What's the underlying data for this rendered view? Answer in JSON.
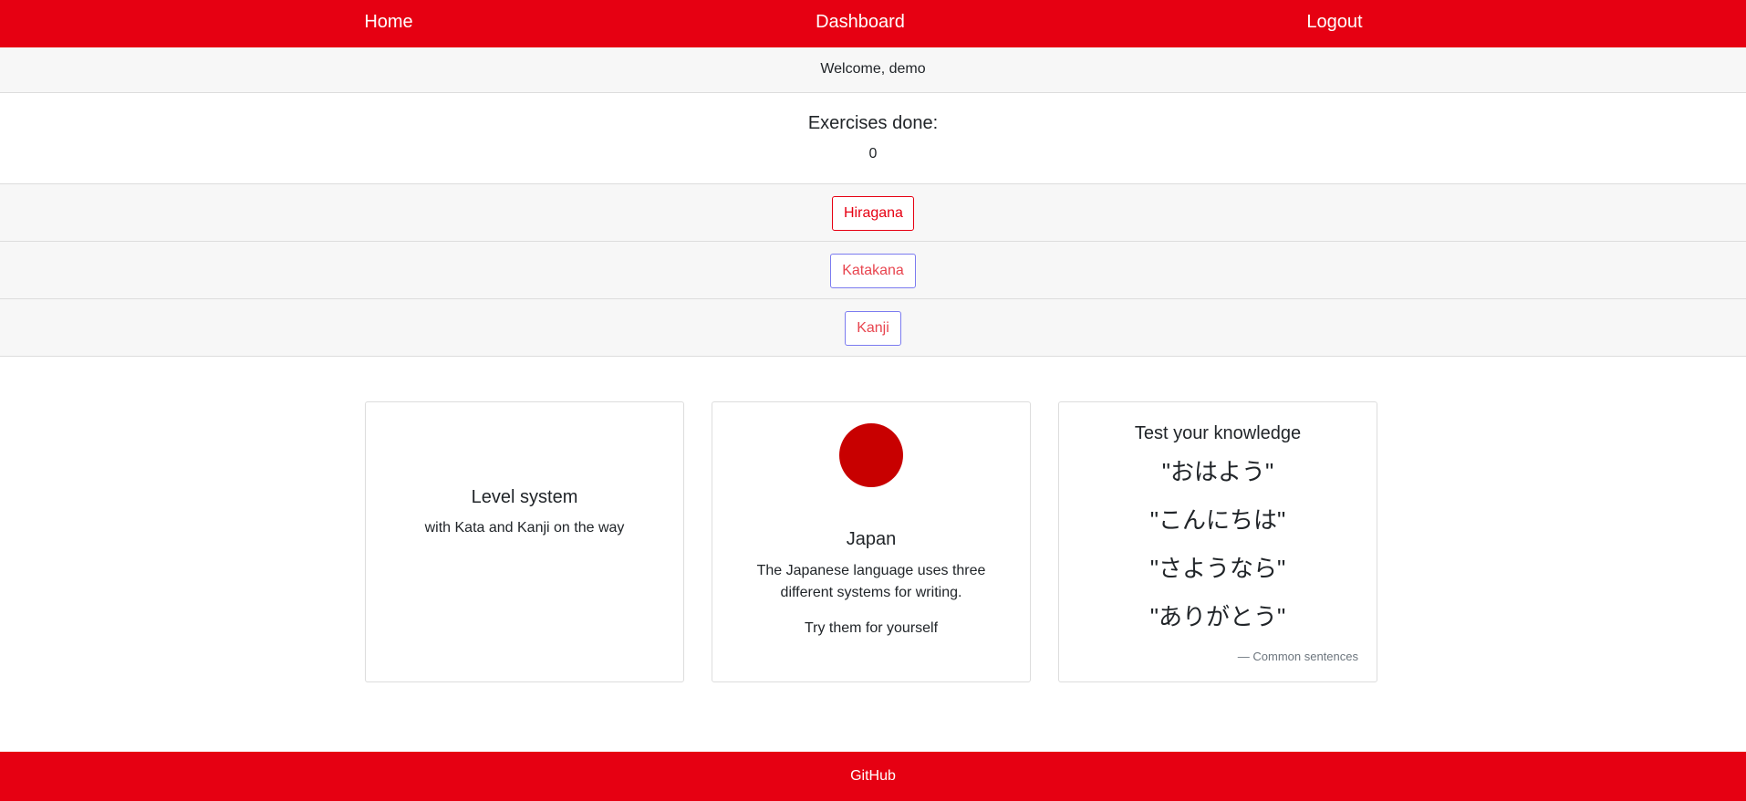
{
  "nav": {
    "home": "Home",
    "dashboard": "Dashboard",
    "logout": "Logout"
  },
  "welcome": "Welcome, demo",
  "exercises": {
    "title": "Exercises done:",
    "count": "0"
  },
  "buttons": {
    "hiragana": "Hiragana",
    "katakana": "Katakana",
    "kanji": "Kanji"
  },
  "cards": {
    "level": {
      "title": "Level system",
      "subtitle": "with Kata and Kanji on the way"
    },
    "japan": {
      "title": "Japan",
      "text": "The Japanese language uses three different systems for writing.",
      "cta": "Try them for yourself"
    },
    "test": {
      "title": "Test your knowledge",
      "sentences": [
        "\"おはよう\"",
        "\"こんにちは\"",
        "\"さようなら\"",
        "\"ありがとう\""
      ],
      "cite": "— Common sentences"
    }
  },
  "footer": {
    "link": "GitHub"
  },
  "colors": {
    "brand_red": "#e60012",
    "sun_red": "#c80000",
    "band_bg": "#f7f7f7"
  }
}
